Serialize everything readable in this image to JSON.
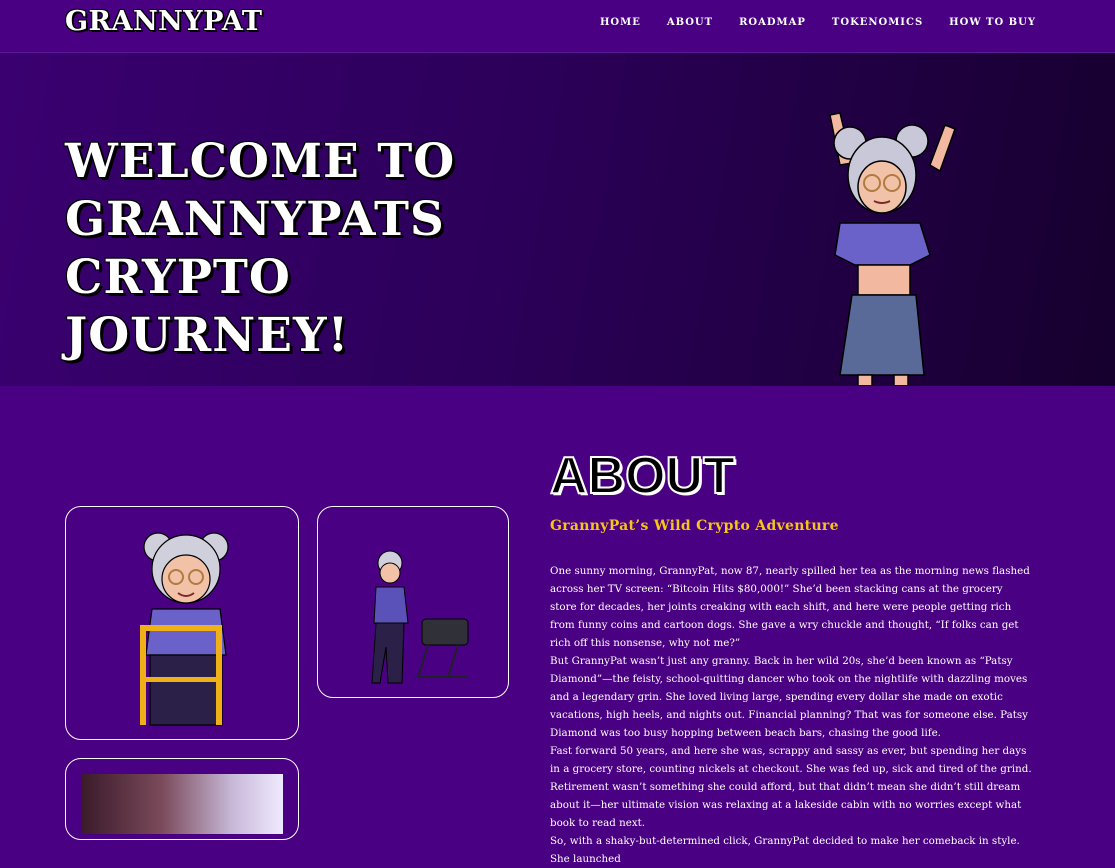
{
  "nav": {
    "logo": "GRANNYPAT",
    "links": [
      "HOME",
      "ABOUT",
      "ROADMAP",
      "TOKENOMICS",
      "HOW TO BUY"
    ]
  },
  "hero": {
    "title_lines": [
      "WELCOME TO",
      "GRANNYPATS",
      "CRYPTO",
      "JOURNEY!"
    ]
  },
  "about": {
    "heading": "ABOUT",
    "subtitle": "GrannyPat’s Wild Crypto Adventure",
    "paragraphs": [
      "One sunny morning, GrannyPat, now 87, nearly spilled her tea as the morning news flashed across her TV screen: “Bitcoin Hits $80,000!” She’d been stacking cans at the grocery store for decades, her joints creaking with each shift, and here were people getting rich from funny coins and cartoon dogs. She gave a wry chuckle and thought, “If folks can get rich off this nonsense, why not me?”",
      "But GrannyPat wasn’t just any granny. Back in her wild 20s, she’d been known as “Patsy Diamond”—the feisty, school-quitting dancer who took on the nightlife with dazzling moves and a legendary grin. She loved living large, spending every dollar she made on exotic vacations, high heels, and nights out. Financial planning? That was for someone else. Patsy Diamond was too busy hopping between beach bars, chasing the good life.",
      "Fast forward 50 years, and here she was, scrappy and sassy as ever, but spending her days in a grocery store, counting nickels at checkout. She was fed up, sick and tired of the grind. Retirement wasn’t something she could afford, but that didn’t mean she didn’t still dream about it—her ultimate vision was relaxing at a lakeside cabin with no worries except what book to read next.",
      "So, with a shaky-but-determined click, GrannyPat decided to make her comeback in style. She launched"
    ]
  },
  "colors": {
    "background": "#4a0082",
    "accent": "#f5c518",
    "hero_gradient_start": "#3a0070",
    "hero_gradient_end": "#16002e"
  }
}
